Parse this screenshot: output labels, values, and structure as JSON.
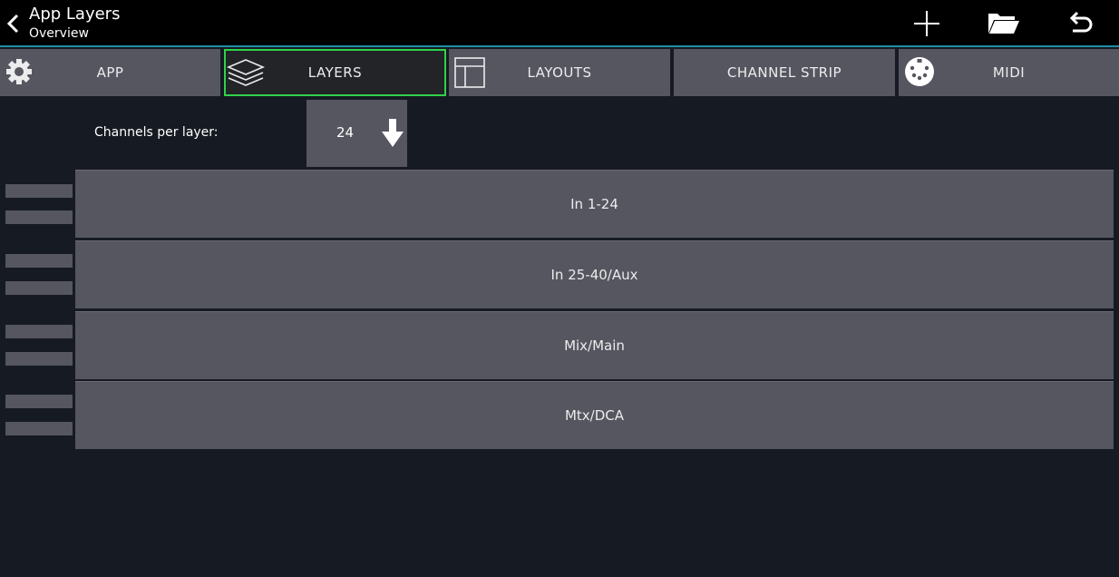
{
  "header": {
    "title": "App Layers",
    "subtitle": "Overview",
    "accent_color": "#1f8ea3",
    "actions": [
      {
        "name": "add-icon"
      },
      {
        "name": "folder-open-icon"
      },
      {
        "name": "undo-icon"
      }
    ]
  },
  "tabs": [
    {
      "label": "APP",
      "icon": "gear-icon",
      "active": false
    },
    {
      "label": "LAYERS",
      "icon": "layers-icon",
      "active": true
    },
    {
      "label": "LAYOUTS",
      "icon": "layout-icon",
      "active": false
    },
    {
      "label": "CHANNEL STRIP",
      "icon": null,
      "active": false
    },
    {
      "label": "MIDI",
      "icon": "midi-connector-icon",
      "active": false
    }
  ],
  "active_tab_color": "#2fd24a",
  "channels_per_layer": {
    "label": "Channels per layer:",
    "value": "24"
  },
  "layers": [
    {
      "label": "In 1-24"
    },
    {
      "label": "In 25-40/Aux"
    },
    {
      "label": "Mix/Main"
    },
    {
      "label": "Mtx/DCA"
    }
  ]
}
